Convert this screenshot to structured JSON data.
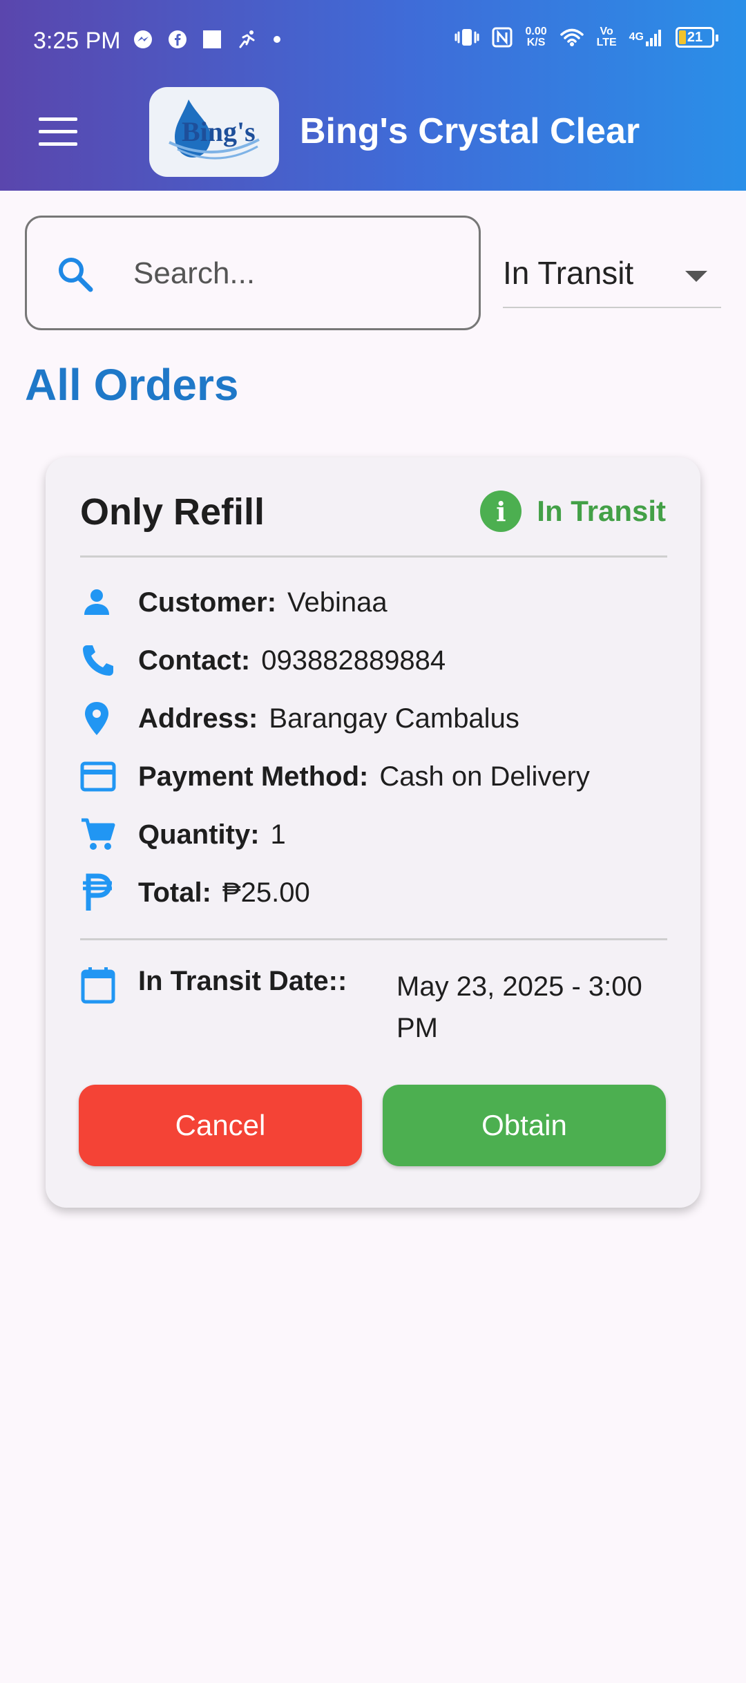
{
  "status_bar": {
    "time": "3:25 PM",
    "net_speed_value": "0.00",
    "net_speed_unit": "K/S",
    "volte_top": "Vo",
    "volte_bottom": "LTE",
    "signal_label": "4G",
    "battery": "21"
  },
  "header": {
    "logo_text": "Bing's",
    "title": "Bing's Crystal Clear"
  },
  "search": {
    "placeholder": "Search..."
  },
  "filter": {
    "selected": "In Transit"
  },
  "section_title": "All Orders",
  "order": {
    "title": "Only Refill",
    "status": "In Transit",
    "status_color": "#43a047",
    "customer_label": "Customer:",
    "customer": "Vebinaa",
    "contact_label": "Contact:",
    "contact": "093882889884",
    "address_label": "Address:",
    "address": "Barangay Cambalus",
    "payment_label": "Payment Method:",
    "payment": "Cash on Delivery",
    "quantity_label": "Quantity:",
    "quantity": "1",
    "total_label": "Total:",
    "total": "₱25.00",
    "date_label": "In Transit Date::",
    "date": "May 23, 2025 - 3:00 PM",
    "cancel_label": "Cancel",
    "obtain_label": "Obtain"
  },
  "colors": {
    "accent_blue": "#1f78c8",
    "icon_blue": "#2196f3",
    "cancel_red": "#f44336",
    "obtain_green": "#4caf50"
  },
  "icons": {
    "customer": "person-icon",
    "contact": "phone-icon",
    "address": "location-pin-icon",
    "payment": "credit-card-icon",
    "quantity": "cart-icon",
    "total": "peso-icon",
    "date": "calendar-icon"
  }
}
